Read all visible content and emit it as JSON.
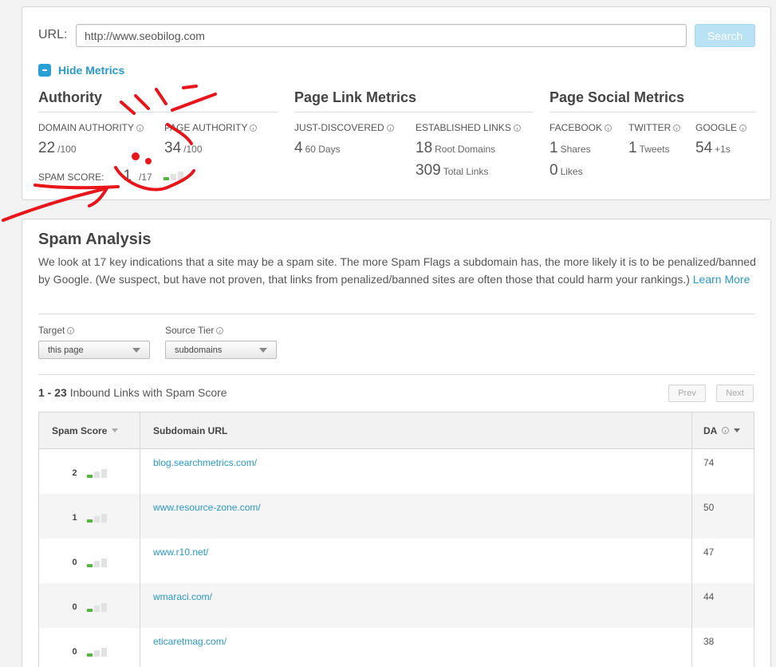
{
  "search": {
    "url_label": "URL:",
    "url_value": "http://www.seobilog.com",
    "button_label": "Search"
  },
  "hide_metrics": "Hide Metrics",
  "authority": {
    "title": "Authority",
    "domain_authority_label": "DOMAIN AUTHORITY",
    "domain_authority_value": "22",
    "domain_authority_unit": "/100",
    "page_authority_label": "PAGE AUTHORITY",
    "page_authority_value": "34",
    "page_authority_unit": "/100",
    "spam_score_label": "SPAM SCORE:",
    "spam_score_value": "1",
    "spam_score_unit": "/17"
  },
  "link_metrics": {
    "title": "Page Link Metrics",
    "just_discovered_label": "JUST-DISCOVERED",
    "just_discovered_value": "4",
    "just_discovered_unit": "60 Days",
    "established_label": "ESTABLISHED LINKS",
    "root_domains_value": "18",
    "root_domains_unit": "Root Domains",
    "total_links_value": "309",
    "total_links_unit": "Total Links"
  },
  "social_metrics": {
    "title": "Page Social Metrics",
    "facebook_label": "FACEBOOK",
    "facebook_shares_value": "1",
    "facebook_shares_unit": "Shares",
    "facebook_likes_value": "0",
    "facebook_likes_unit": "Likes",
    "twitter_label": "TWITTER",
    "twitter_value": "1",
    "twitter_unit": "Tweets",
    "google_label": "GOOGLE",
    "google_value": "54",
    "google_unit": "+1s"
  },
  "spam_analysis": {
    "title": "Spam Analysis",
    "description": "We look at 17 key indications that a site may be a spam site. The more Spam Flags a subdomain has, the more likely it is to be penalized/banned by Google. (We suspect, but have not proven, that links from penalized/banned sites are often those that could harm your rankings.)",
    "learn_more": "Learn More",
    "target_label": "Target",
    "target_value": "this page",
    "source_tier_label": "Source Tier",
    "source_tier_value": "subdomains",
    "results_range": "1 - 23",
    "results_text": "Inbound Links with Spam Score",
    "prev_label": "Prev",
    "next_label": "Next"
  },
  "table": {
    "headers": {
      "spam_score": "Spam Score",
      "subdomain_url": "Subdomain URL",
      "da": "DA"
    },
    "rows": [
      {
        "score": "2",
        "url": "blog.searchmetrics.com/",
        "da": "74"
      },
      {
        "score": "1",
        "url": "www.resource-zone.com/",
        "da": "50"
      },
      {
        "score": "0",
        "url": "www.r10.net/",
        "da": "47"
      },
      {
        "score": "0",
        "url": "wmaraci.com/",
        "da": "44"
      },
      {
        "score": "0",
        "url": "eticaretmag.com/",
        "da": "38"
      }
    ]
  },
  "colors": {
    "accent": "#2a98c9",
    "spam_bar_on": "#55b640",
    "annotation": "#e8161b"
  }
}
